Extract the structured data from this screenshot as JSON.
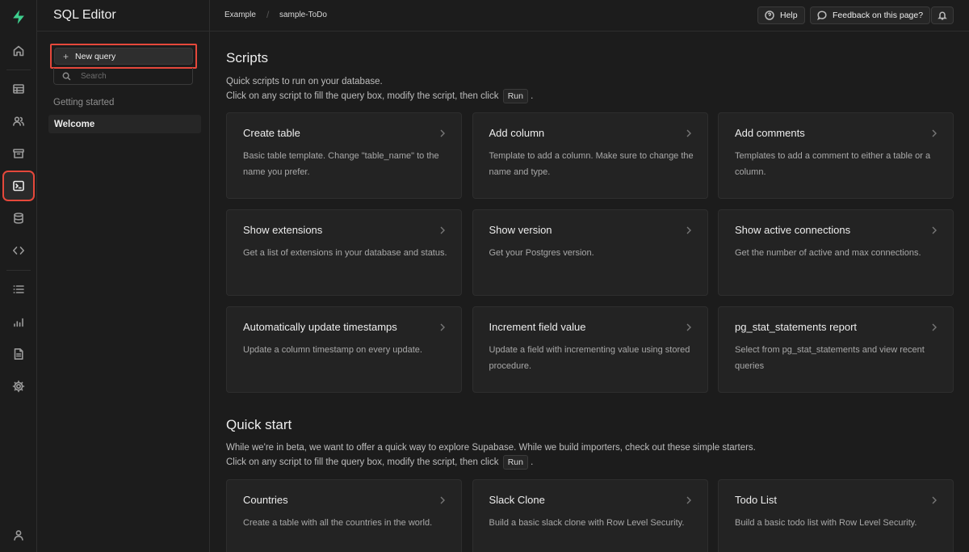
{
  "sidebar": {
    "title": "SQL Editor",
    "new_query_label": "New query",
    "search_placeholder": "Search",
    "group_label": "Getting started",
    "items": [
      {
        "label": "Welcome"
      }
    ]
  },
  "breadcrumb": {
    "items": [
      "Example",
      "sample-ToDo"
    ]
  },
  "topbar": {
    "help_label": "Help",
    "feedback_label": "Feedback on this page?"
  },
  "scripts": {
    "title": "Scripts",
    "desc_line1": "Quick scripts to run on your database.",
    "desc_line2": "Click on any script to fill the query box, modify the script, then click",
    "run_label": "Run",
    "trailing": ".",
    "cards": [
      {
        "title": "Create table",
        "desc": "Basic table template. Change \"table_name\" to the name you prefer."
      },
      {
        "title": "Add column",
        "desc": "Template to add a column. Make sure to change the name and type."
      },
      {
        "title": "Add comments",
        "desc": "Templates to add a comment to either a table or a column."
      },
      {
        "title": "Show extensions",
        "desc": "Get a list of extensions in your database and status."
      },
      {
        "title": "Show version",
        "desc": "Get your Postgres version."
      },
      {
        "title": "Show active connections",
        "desc": "Get the number of active and max connections."
      },
      {
        "title": "Automatically update timestamps",
        "desc": "Update a column timestamp on every update."
      },
      {
        "title": "Increment field value",
        "desc": "Update a field with incrementing value using stored procedure."
      },
      {
        "title": "pg_stat_statements report",
        "desc": "Select from pg_stat_statements and view recent queries"
      }
    ]
  },
  "quickstart": {
    "title": "Quick start",
    "desc_line1": "While we're in beta, we want to offer a quick way to explore Supabase. While we build importers, check out these simple starters.",
    "desc_line2": "Click on any script to fill the query box, modify the script, then click",
    "run_label": "Run",
    "trailing": ".",
    "cards": [
      {
        "title": "Countries",
        "desc": "Create a table with all the countries in the world."
      },
      {
        "title": "Slack Clone",
        "desc": "Build a basic slack clone with Row Level Security."
      },
      {
        "title": "Todo List",
        "desc": "Build a basic todo list with Row Level Security."
      }
    ]
  },
  "icons": {
    "logo": "supabase-logo-icon",
    "rail": [
      "home-icon",
      "table-editor-icon",
      "auth-users-icon",
      "storage-icon",
      "sql-editor-icon",
      "database-icon",
      "api-code-icon",
      "logs-list-icon",
      "reports-chart-icon",
      "docs-icon",
      "settings-gear-icon",
      "profile-user-icon"
    ]
  },
  "colors": {
    "accent": "#3ecf8e",
    "highlight": "#e5483b",
    "background": "#1c1c1c",
    "card": "#232323"
  }
}
